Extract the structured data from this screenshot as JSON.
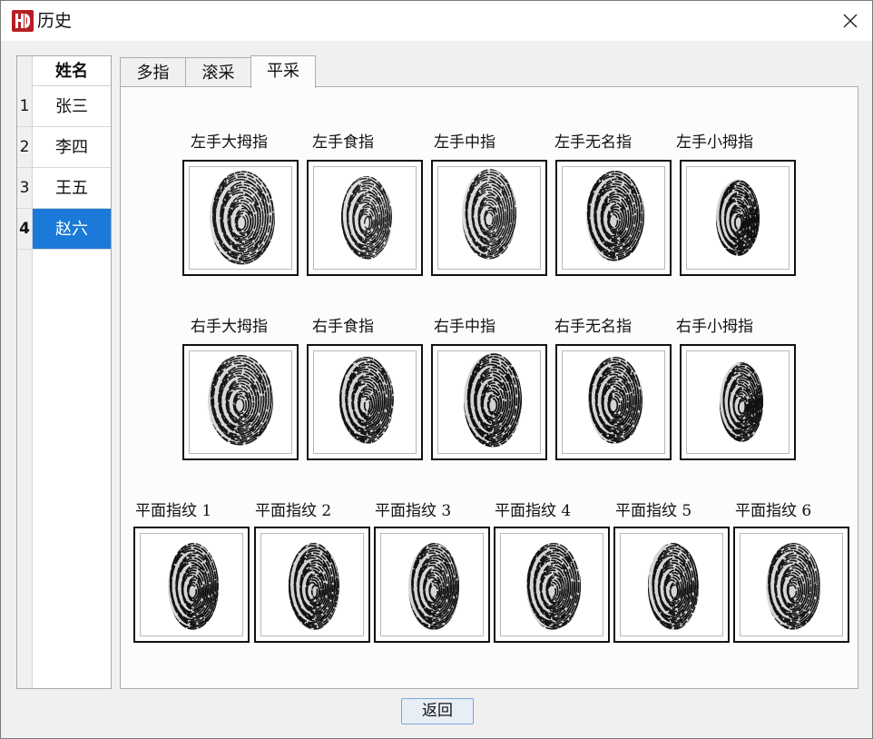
{
  "window": {
    "title": "历史"
  },
  "names": {
    "header": "姓名",
    "rows": [
      {
        "num": "1",
        "name": "张三"
      },
      {
        "num": "2",
        "name": "李四"
      },
      {
        "num": "3",
        "name": "王五"
      },
      {
        "num": "4",
        "name": "赵六"
      }
    ],
    "selected_index": 3
  },
  "tabs": [
    "多指",
    "滚采",
    "平采"
  ],
  "active_tab": "平采",
  "fingers": {
    "left": [
      "左手大拇指",
      "左手食指",
      "左手中指",
      "左手无名指",
      "左手小拇指"
    ],
    "right": [
      "右手大拇指",
      "右手食指",
      "右手中指",
      "右手无名指",
      "右手小拇指"
    ],
    "flat": [
      "平面指纹 1",
      "平面指纹 2",
      "平面指纹 3",
      "平面指纹 4",
      "平面指纹 5",
      "平面指纹 6"
    ]
  },
  "buttons": {
    "back": "返回"
  },
  "colors": {
    "selection": "#1b7ad9",
    "logo": "#b51f24"
  }
}
